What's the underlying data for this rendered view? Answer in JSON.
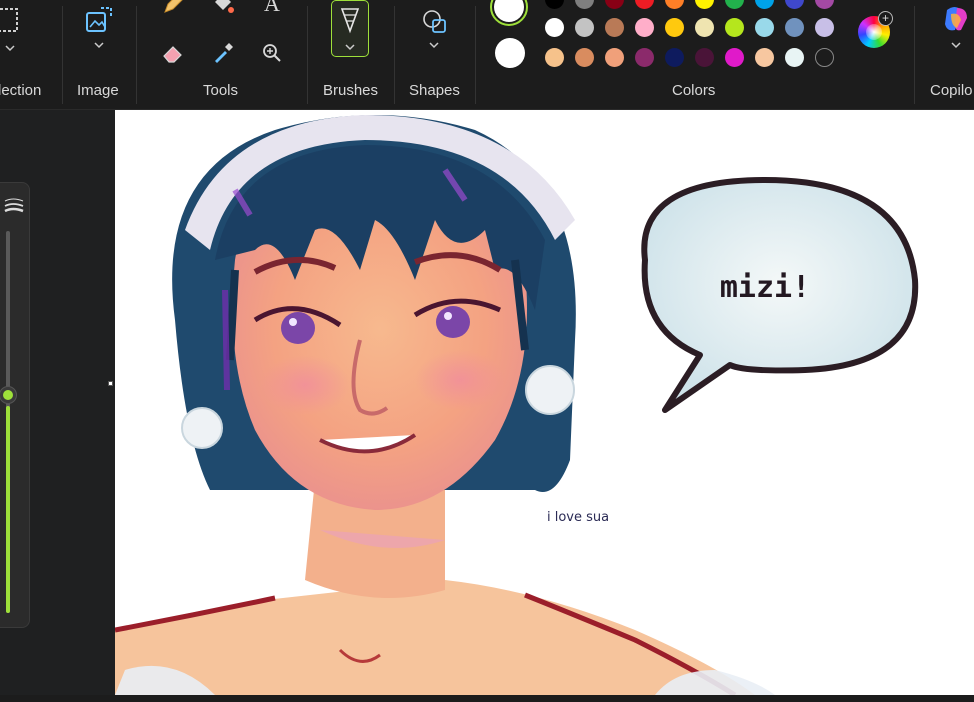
{
  "ribbon": {
    "groups": [
      {
        "id": "selection",
        "label": "lection"
      },
      {
        "id": "image",
        "label": "Image"
      },
      {
        "id": "tools",
        "label": "Tools"
      },
      {
        "id": "brushes",
        "label": "Brushes"
      },
      {
        "id": "shapes",
        "label": "Shapes"
      },
      {
        "id": "colors",
        "label": "Colors"
      },
      {
        "id": "copilot",
        "label": "Copilo"
      }
    ],
    "tools": {
      "text_tool_glyph": "A"
    },
    "accent": "#9ee03a"
  },
  "colors": {
    "primary": "#ffffff",
    "secondary": "#ffffff",
    "palette_row1": [
      "#000000",
      "#7f7f7f",
      "#880015",
      "#ed1c24",
      "#ff7f27",
      "#fff200",
      "#22b14c",
      "#00a2e8",
      "#3f48cc",
      "#a349a4"
    ],
    "palette_row2": [
      "#ffffff",
      "#c3c3c3",
      "#b97a57",
      "#ffaec9",
      "#ffc90e",
      "#efe4b0",
      "#b5e61d",
      "#99d9ea",
      "#7092be",
      "#c8bfe7"
    ],
    "palette_row3": [
      "#f6c28b",
      "#d98c5f",
      "#f0a07a",
      "#8b2a6b",
      "#0e1b5e",
      "#4a1438",
      "#e01ac9",
      "#f7c7a0",
      "#e8f4f4",
      "empty"
    ]
  },
  "canvas": {
    "speech_bubble_text": "mizi!",
    "caption": "i love sua"
  },
  "brush_size": {
    "level_percent": 51
  }
}
